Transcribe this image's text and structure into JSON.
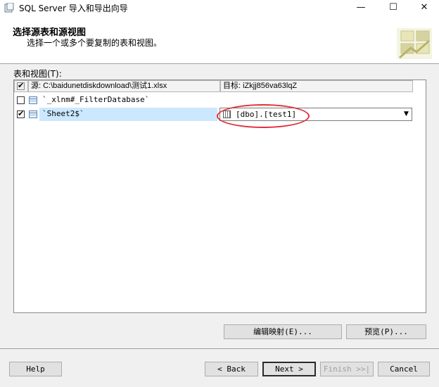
{
  "window": {
    "title": "SQL Server 导入和导出向导",
    "minimize_glyph": "—",
    "maximize_glyph": "☐",
    "close_glyph": "✕"
  },
  "header": {
    "title": "选择源表和源视图",
    "subtitle": "选择一个或多个要复制的表和视图。"
  },
  "tables_label": "表和视图(T):",
  "grid": {
    "source_header": "源: C:\\baidunetdiskdownload\\测试1.xlsx",
    "target_header": "目标: iZkjj856va63lqZ",
    "rows": [
      {
        "checked": false,
        "source": "`_xlnm#_FilterDatabase`",
        "target": ""
      },
      {
        "checked": true,
        "source": "`Sheet2$`",
        "target": "[dbo].[test1]"
      }
    ]
  },
  "buttons": {
    "edit_mappings": "编辑映射(E)...",
    "preview": "预览(P)...",
    "help": "Help",
    "back": "< Back",
    "next": "Next >",
    "finish": "Finish >>|",
    "cancel": "Cancel"
  },
  "annotation_color": "#e0303a"
}
